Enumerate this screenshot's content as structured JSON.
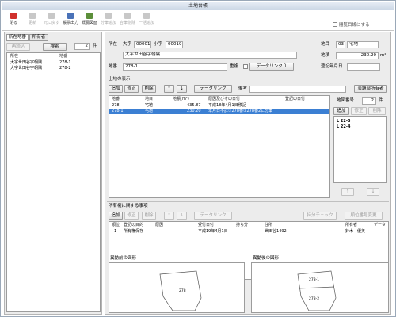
{
  "window": {
    "title": "土地台帳"
  },
  "toolbar": {
    "buttons": [
      {
        "label": "閉る",
        "icon": "close-icon",
        "enabled": true,
        "color": "#d0312d"
      },
      {
        "label": "更新",
        "icon": "refresh-icon",
        "enabled": false,
        "color": "#b8b8b8"
      },
      {
        "label": "元に戻す",
        "icon": "undo-icon",
        "enabled": false,
        "color": "#b8b8b8"
      },
      {
        "label": "帳票出力",
        "icon": "report-icon",
        "enabled": true,
        "color": "#4a72b8"
      },
      {
        "label": "概要図面",
        "icon": "drawing-icon",
        "enabled": true,
        "color": "#5c8f3a"
      },
      {
        "label": "分筆追加",
        "icon": "split-icon",
        "enabled": false,
        "color": "#b8b8b8"
      },
      {
        "label": "合筆削除",
        "icon": "merge-icon",
        "enabled": false,
        "color": "#b8b8b8"
      },
      {
        "label": "一括追加",
        "icon": "bulk-add-icon",
        "enabled": false,
        "color": "#b8b8b8"
      }
    ],
    "checkbox_label": "閲覧目線にする"
  },
  "left": {
    "tabs": [
      "所在地番",
      "所有者"
    ],
    "reload": "再読込",
    "search": "検索",
    "count": "2",
    "count_unit": "件",
    "col_location": "所在",
    "col_number": "地番",
    "rows": [
      {
        "location": "大字世田谷字朝隅",
        "number": "278-1"
      },
      {
        "location": "大字世田谷字朝隅",
        "number": "278-2"
      }
    ]
  },
  "header": {
    "shozai_label": "所在",
    "oaza_label": "大字",
    "oaza_code": "00001",
    "koaza_label": "小字",
    "koaza_code": "00019",
    "shozai_name": "大字世田谷字朝隅",
    "chimoku_label": "地目",
    "chimoku_code": "03",
    "chimoku_name": "宅地",
    "chiseki_label": "地積",
    "chiseki_value": "230.20",
    "chiseki_unit": "m²",
    "chiban_label": "地番",
    "chiban_value": "278-1",
    "kashitsu_label": "重複",
    "datalink_button": "データリンク０",
    "toki_label": "登記年月日"
  },
  "land": {
    "section_label": "土地の表示",
    "add": "追加",
    "edit": "修正",
    "delete": "削除",
    "up": "↑",
    "down": "↓",
    "datalink": "データリンク",
    "biko_label": "備考",
    "owner_btn": "表題部所有者",
    "cols": [
      "地番",
      "地目",
      "地積(m²)",
      "原因及びその日付",
      "登記の日付"
    ],
    "rows": [
      {
        "chiban": "278",
        "chimoku": "宅地",
        "chiseki": "435.87",
        "cause": "平成18年4月1日移記",
        "date": ""
      },
      {
        "chiban": "278-1",
        "chimoku": "宅地",
        "chiseki": "230.20",
        "cause": "年月日不詳①278番①278番2に分筆",
        "date": ""
      }
    ],
    "map_label": "地図番号",
    "map_count": "2",
    "map_unit": "件",
    "map_items": [
      "L 22-3",
      "L 22-4"
    ],
    "side_add": "追加",
    "side_edit": "修正",
    "side_delete": "削除"
  },
  "ownership": {
    "section_label": "所有権に関する事項",
    "add": "追加",
    "edit": "修正",
    "delete": "削除",
    "up": "↑",
    "down": "↓",
    "datalink": "データリンク",
    "mochibun_check": "持分チェック",
    "order_change": "順位番号変更",
    "cols": [
      "順位",
      "登記の目的",
      "原因",
      "受付日付",
      "持ち分",
      "住所",
      "所有者",
      "データ"
    ],
    "rows": [
      {
        "rank": "1",
        "purpose": "所有権保存",
        "cause": "",
        "date": "平成19年4月1日",
        "share": "",
        "address": "世田谷1492",
        "owner": "鈴木　優美"
      }
    ]
  },
  "figures": {
    "before_label": "異動前の図形",
    "after_label": "異動後の図形",
    "before_parcel": "278",
    "after_parcels": [
      "278-1",
      "278-2"
    ]
  }
}
